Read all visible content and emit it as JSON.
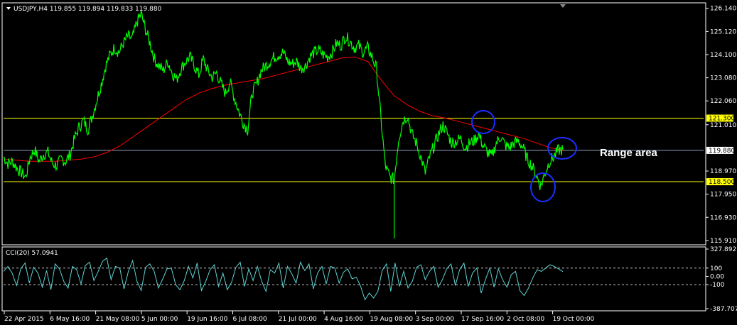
{
  "header": {
    "symbol_line": "USDJPY,H4 119.855 119.894 119.833 119.880",
    "indicator_line": "CCI(20) 57.0941"
  },
  "annotation": {
    "text": "Range area"
  },
  "colors": {
    "background": "#000000",
    "price": "#00ff00",
    "moving_average": "#ff0000",
    "support_resistance": "#ffff00",
    "current_price_line": "#8fa0c8",
    "cci": "#5fd3d3",
    "circles": "#1a2fff",
    "axis": "#ffffff"
  },
  "chart_data": [
    {
      "type": "line",
      "name": "price",
      "x_ticks": [
        "22 Apr 2015",
        "6 May 16:00",
        "21 May 08:00",
        "5 Jun 00:00",
        "19 Jun 16:00",
        "6 Jul 08:00",
        "21 Jul 00:00",
        "4 Aug 16:00",
        "19 Aug 08:00",
        "3 Sep 00:00",
        "17 Sep 16:00",
        "2 Oct 08:00",
        "19 Oct 00:00"
      ],
      "y_ticks": [
        "126.140",
        "125.120",
        "124.100",
        "123.080",
        "122.060",
        "121.010",
        "119.880",
        "118.970",
        "117.950",
        "116.930",
        "115.910"
      ],
      "y_tick_values": [
        126.14,
        125.12,
        124.1,
        123.08,
        122.06,
        121.01,
        119.88,
        118.97,
        117.95,
        116.93,
        115.91
      ],
      "ylim": [
        115.75,
        126.35
      ],
      "horizontal_lines": [
        {
          "value": 121.3,
          "label": "121.300"
        },
        {
          "value": 118.5,
          "label": "118.500"
        }
      ],
      "current_price": {
        "value": 119.88,
        "label": "119.880"
      },
      "series": [
        {
          "values": [
            119.6,
            119.3,
            119.4,
            119.1,
            118.9,
            118.7,
            119.6,
            119.9,
            119.4,
            119.7,
            119.8,
            119.3,
            119.2,
            119.5,
            119.4,
            119.7,
            120.4,
            120.9,
            121.2,
            120.8,
            121.4,
            122.1,
            122.8,
            123.6,
            124.1,
            124.4,
            124.2,
            124.6,
            124.9,
            124.8,
            125.5,
            125.9,
            125.2,
            124.6,
            123.9,
            123.6,
            123.4,
            123.8,
            123.3,
            123.0,
            123.5,
            123.8,
            124.0,
            123.6,
            123.2,
            123.9,
            123.4,
            123.1,
            123.3,
            122.8,
            122.4,
            122.9,
            122.2,
            121.6,
            121.1,
            120.8,
            122.4,
            122.8,
            123.4,
            123.6,
            123.8,
            124.0,
            124.1,
            124.2,
            123.8,
            123.7,
            123.8,
            123.5,
            123.6,
            124.0,
            124.2,
            124.3,
            124.1,
            124.0,
            124.2,
            124.6,
            124.5,
            124.9,
            124.7,
            124.4,
            124.5,
            124.2,
            124.4,
            124.0,
            123.5,
            121.3,
            119.2,
            118.7,
            118.6,
            120.4,
            121.2,
            121.4,
            120.6,
            120.2,
            119.6,
            118.9,
            119.6,
            120.1,
            120.6,
            121.0,
            120.6,
            120.2,
            120.3,
            120.4,
            120.0,
            120.2,
            120.3,
            120.6,
            120.1,
            119.8,
            119.6,
            120.2,
            120.5,
            120.1,
            120.0,
            120.2,
            120.3,
            120.0,
            119.5,
            119.2,
            118.8,
            118.3,
            118.9,
            119.4,
            119.6,
            119.9,
            119.9
          ],
          "low": 116.0,
          "low_index": 88
        },
        {
          "type": "line",
          "name": "moving_average",
          "values": [
            119.5,
            119.45,
            119.4,
            119.4,
            119.4,
            119.45,
            119.5,
            119.6,
            119.8,
            120.1,
            120.5,
            120.9,
            121.3,
            121.7,
            122.1,
            122.4,
            122.6,
            122.75,
            122.85,
            122.95,
            123.05,
            123.2,
            123.35,
            123.5,
            123.65,
            123.8,
            123.95,
            124.0,
            123.8,
            123.0,
            122.3,
            121.9,
            121.6,
            121.4,
            121.3,
            121.15,
            121.0,
            120.85,
            120.7,
            120.55,
            120.4,
            120.2,
            120.0,
            119.88
          ]
        }
      ]
    },
    {
      "type": "line",
      "name": "cci",
      "title": "CCI(20) 57.0941",
      "y_ticks": [
        "327.8927",
        "100",
        "0.00",
        "-100",
        "-387.707"
      ],
      "y_tick_values": [
        327.8927,
        100,
        0,
        -100,
        -387.707
      ],
      "ylim": [
        -387.707,
        327.8927
      ],
      "levels": [
        100,
        -100
      ],
      "values": [
        60,
        120,
        40,
        -110,
        90,
        160,
        -80,
        110,
        40,
        -130,
        70,
        -160,
        150,
        90,
        -60,
        -140,
        120,
        80,
        -90,
        130,
        170,
        -50,
        60,
        180,
        220,
        -40,
        120,
        100,
        -150,
        60,
        190,
        -60,
        -170,
        110,
        150,
        60,
        -140,
        -30,
        90,
        100,
        -100,
        -160,
        -50,
        120,
        -20,
        160,
        -170,
        -60,
        80,
        140,
        -120,
        40,
        -160,
        -70,
        110,
        170,
        -120,
        90,
        -50,
        120,
        -60,
        -180,
        80,
        40,
        160,
        -140,
        120,
        30,
        -80,
        170,
        70,
        150,
        -150,
        40,
        120,
        -90,
        120,
        100,
        -80,
        50,
        90,
        -30,
        -10,
        -120,
        -280,
        -200,
        -260,
        -180,
        70,
        150,
        -180,
        160,
        -120,
        60,
        -140,
        -60,
        110,
        140,
        -40,
        60,
        120,
        -130,
        -40,
        90,
        150,
        -110,
        80,
        160,
        -120,
        40,
        100,
        -200,
        -40,
        100,
        -130,
        90,
        -40,
        -130,
        20,
        60,
        -170,
        -230,
        -140,
        -20,
        80,
        60,
        100,
        140,
        120,
        90,
        57
      ]
    }
  ]
}
